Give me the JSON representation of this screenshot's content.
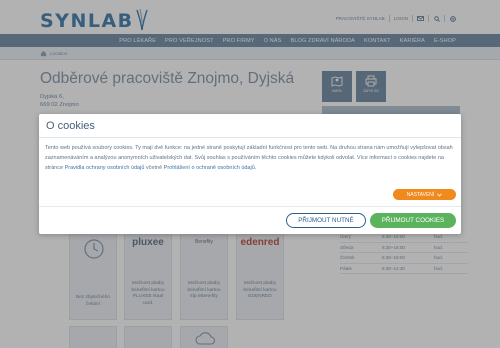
{
  "brand": {
    "name": "SYNLAB"
  },
  "utility": {
    "links": [
      "PRACOVIŠTĚ SYNLAB",
      "LOGIN"
    ],
    "icons": [
      "mail-icon",
      "search-icon",
      "language-icon"
    ]
  },
  "nav": {
    "items": [
      "PRO LÉKAŘE",
      "PRO VEŘEJNOST",
      "PRO FIRMY",
      "O NÁS",
      "BLOG ZDRAVÍ NÁRODA",
      "KONTAKT",
      "KARIÉRA",
      "E-SHOP"
    ]
  },
  "breadcrumb": {
    "current": "Location"
  },
  "page": {
    "title": "Odběrové pracoviště Znojmo, Dyjská",
    "address_line1": "Dyjská 6,",
    "address_line2": "669 02 Znojmo"
  },
  "quick_actions": [
    {
      "label": "MAPA",
      "icon": "map-icon"
    },
    {
      "label": "ZÁPIS DO",
      "icon": "print-icon"
    }
  ],
  "cards": [
    {
      "logo": "",
      "text": [
        "Bez zbytečného",
        "čekání"
      ],
      "icon": "clock-icon"
    },
    {
      "logo": "pluxee",
      "text": [
        "Možnost platby",
        "benefitní kartou",
        "PLUXEE Ikaal",
        "card."
      ]
    },
    {
      "logo": "Benefity",
      "text": [
        "Možnost platby",
        "benefitní kartou",
        "síp eBenefity"
      ]
    },
    {
      "logo": "edenred",
      "text": [
        "Možnost platby",
        "benefitní kartou",
        "EDENRED"
      ]
    }
  ],
  "hours": [
    {
      "day": "Úterý",
      "time": "6:30–15:00",
      "unit": "hod."
    },
    {
      "day": "Středa",
      "time": "6:30–15:00",
      "unit": "hod."
    },
    {
      "day": "Čtvrtek",
      "time": "6:30–15:00",
      "unit": "hod."
    },
    {
      "day": "Pátek",
      "time": "6:30–14:30",
      "unit": "hod."
    }
  ],
  "cookie_modal": {
    "title": "O cookies",
    "text_part1": "Tento web používá soubory cookies. Ty mají dvě funkce: na jedné straně poskytují základní funkčnost pro tento web. Na druhou strana nám umožňují vylepšovat obsah zaznamenáváním a analýzou anonymních uživatelských dat. Svůj souhlas s používáním těchto cookies můžete kdykoli odvolat. Více informací o cookies najdete na stránce ",
    "link1": "Pravidla ochrany osobních údajů",
    "text_part2": " včetně ",
    "link2": "Prohlášení o ochraně osobních údajů",
    "text_part3": ".",
    "settings_label": "NASTAVENÍ",
    "necessary_label": "PŘIJMOUT NUTNÉ",
    "all_label": "PŘIJMOUT COOKIES"
  },
  "colors": {
    "brand_blue": "#4f87b4",
    "nav_bg": "#7d97ae",
    "accent_orange": "#f08a1c",
    "accept_green": "#5bb35e",
    "outline_blue": "#2d5f8c"
  }
}
